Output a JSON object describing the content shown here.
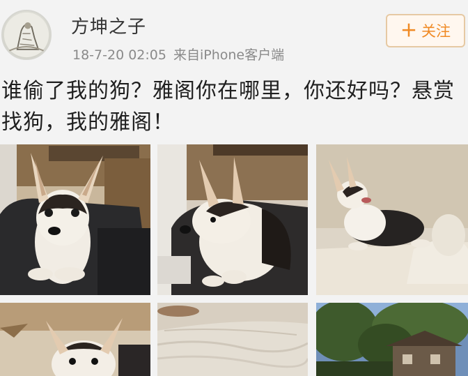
{
  "post": {
    "author": "方坤之子",
    "timestamp": "18-7-20 02:05",
    "source": "来自iPhone客户端",
    "follow_label": "关注",
    "text": "谁偷了我的狗？雅阁你在哪里，你还好吗？悬赏找狗，我的雅阁！"
  },
  "images": [
    {
      "subject": "corgi-on-chair-facing"
    },
    {
      "subject": "corgi-on-chair-profile"
    },
    {
      "subject": "corgi-on-sofa"
    },
    {
      "subject": "corgi-closeup"
    },
    {
      "subject": "carpet"
    },
    {
      "subject": "trees-and-house"
    }
  ],
  "colors": {
    "accent": "#f08a24",
    "follow_border": "#e6c9a3",
    "meta_text": "#8a8a8a"
  }
}
